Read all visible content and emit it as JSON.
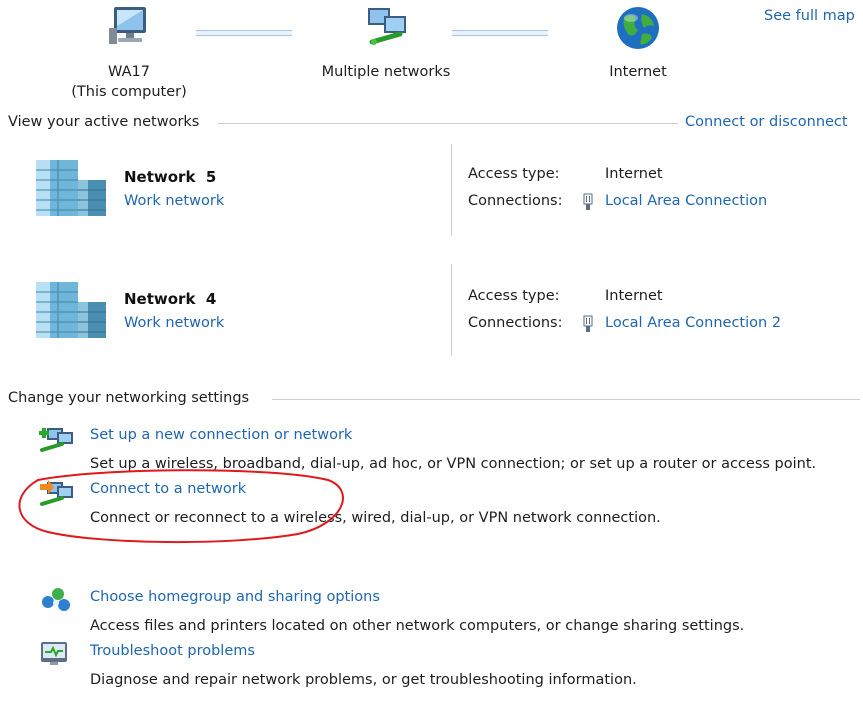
{
  "map": {
    "computer_name": "WA17",
    "computer_caption": "(This computer)",
    "networks_label": "Multiple networks",
    "internet_label": "Internet",
    "see_full_map": "See full map"
  },
  "active": {
    "heading": "View your active networks",
    "connect_link": "Connect or disconnect",
    "networks": [
      {
        "name": "Network  5",
        "category": "Work network",
        "access_label": "Access type:",
        "access_value": "Internet",
        "connections_label": "Connections:",
        "connection": "Local Area Connection"
      },
      {
        "name": "Network  4",
        "category": "Work network",
        "access_label": "Access type:",
        "access_value": "Internet",
        "connections_label": "Connections:",
        "connection": "Local Area Connection 2"
      }
    ]
  },
  "settings": {
    "heading": "Change your networking settings",
    "tasks": [
      {
        "title": "Set up a new connection or network",
        "description": "Set up a wireless, broadband, dial-up, ad hoc, or VPN connection; or set up a router or access point.",
        "icon": "new-connection-icon"
      },
      {
        "title": "Connect to a network",
        "description": "Connect or reconnect to a wireless, wired, dial-up, or VPN network connection.",
        "icon": "connect-network-icon"
      },
      {
        "title": "Choose homegroup and sharing options",
        "description": "Access files and printers located on other network computers, or change sharing settings.",
        "icon": "homegroup-icon"
      },
      {
        "title": "Troubleshoot problems",
        "description": "Diagnose and repair network problems, or get troubleshooting information.",
        "icon": "troubleshoot-icon"
      }
    ]
  },
  "annotation": {
    "color": "#e0191f"
  }
}
